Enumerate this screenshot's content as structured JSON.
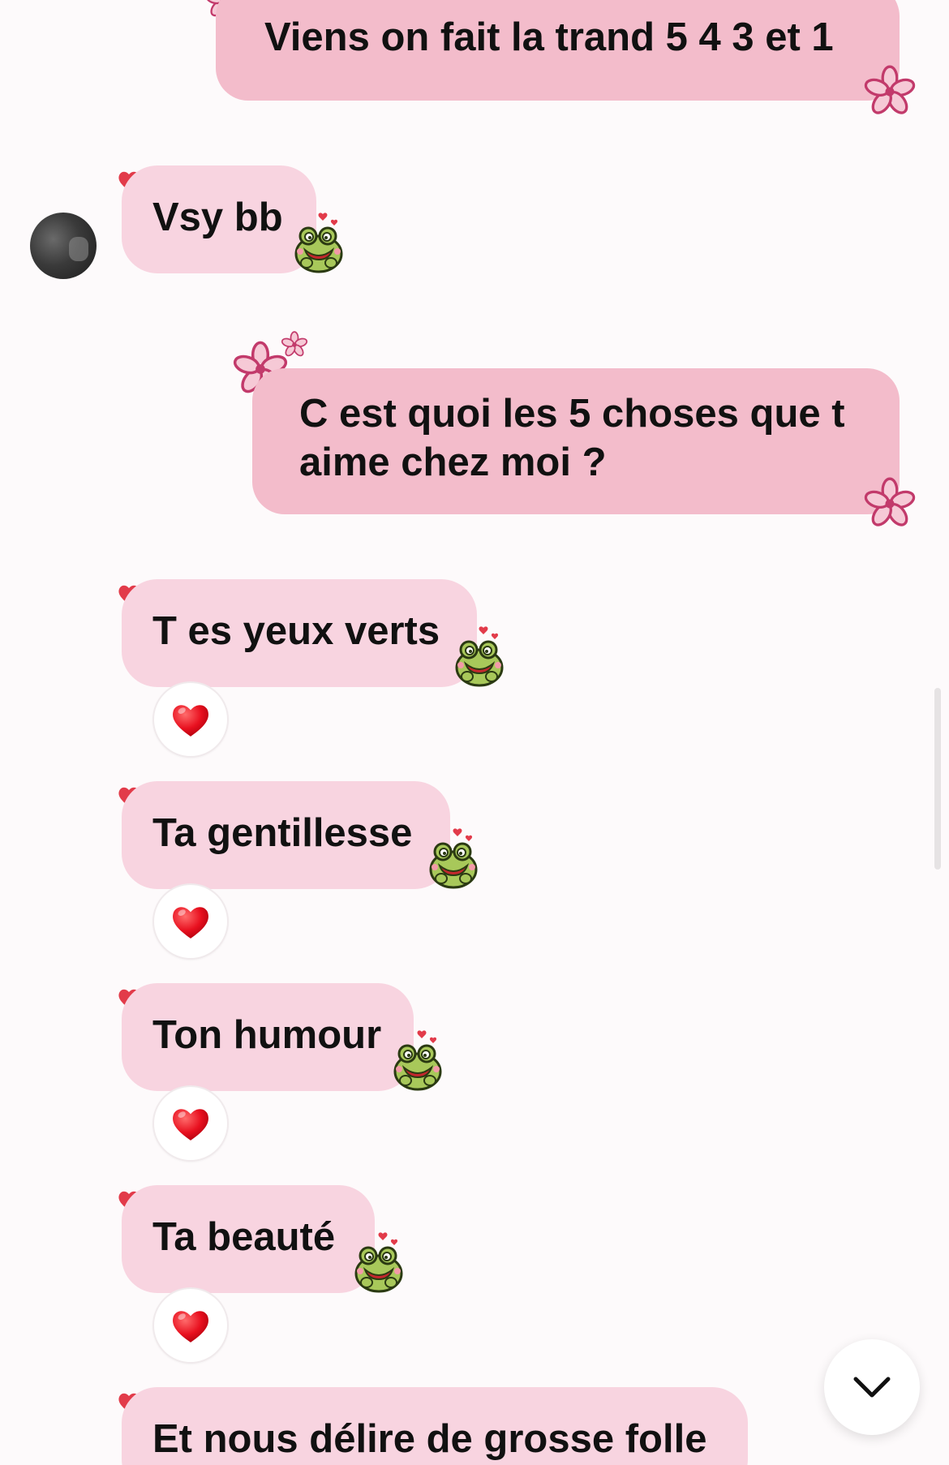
{
  "messages": {
    "m1": {
      "text": "Viens on fait la trand 5 4 3 et 1"
    },
    "m2": {
      "text": "Vsy bb"
    },
    "m3": {
      "line1": "C est quoi les 5 choses que t",
      "line2": "aime chez moi ?"
    },
    "m4": {
      "text": "T es yeux verts",
      "reaction": "heart"
    },
    "m5": {
      "text": "Ta gentillesse",
      "reaction": "heart"
    },
    "m6": {
      "text": "Ton humour",
      "reaction": "heart"
    },
    "m7": {
      "text": "Ta beauté",
      "reaction": "heart"
    },
    "m8": {
      "text": "Et nous délire de grosse folle"
    }
  },
  "icons": {
    "outgoing_decoration": "flower-icon",
    "incoming_decoration": "frog-sticker-icon",
    "incoming_corner": "heart-icon",
    "reaction": "red-heart-icon",
    "scroll_down": "chevron-down-icon"
  },
  "colors": {
    "outgoing_bubble": "#f3bccb",
    "incoming_bubble": "#f8d4e0",
    "flower": "#c23a6b",
    "heart": "#e23b4a",
    "frog": "#a8c85a"
  }
}
